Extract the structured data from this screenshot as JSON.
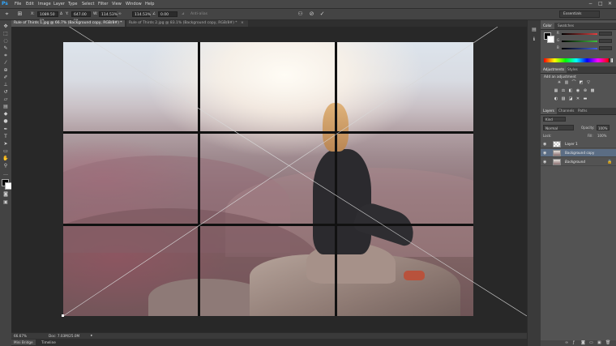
{
  "app": {
    "logo": "Ps"
  },
  "menu": [
    "File",
    "Edit",
    "Image",
    "Layer",
    "Type",
    "Select",
    "Filter",
    "View",
    "Window",
    "Help"
  ],
  "window_controls": {
    "minimize": "−",
    "maximize": "□",
    "close": "✕"
  },
  "options": {
    "x_label": "X:",
    "x_value": "1089.50 px",
    "y_label": "Y:",
    "y_value": "647.00 px",
    "w_label": "W:",
    "w_value": "114.53%",
    "h_value": "114.53%",
    "angle_value": "0.00",
    "antialias_label": "Anti-alias",
    "workspace": "Essentials"
  },
  "tabs": [
    {
      "label": "Rule of Thirds 1.jpg @ 66.7% (Background copy, RGB/8#) *",
      "close": "×",
      "active": true
    },
    {
      "label": "Rule of Thirds 2.jpg @ 83.1% (Background copy, RGB/8#) *",
      "close": "×",
      "active": false
    }
  ],
  "color_panel": {
    "tabs": [
      "Color",
      "Swatches"
    ],
    "sliders": [
      {
        "label": "R",
        "color": "#e04040"
      },
      {
        "label": "G",
        "color": "#40c040"
      },
      {
        "label": "B",
        "color": "#4060e0"
      }
    ]
  },
  "adjustments_panel": {
    "tabs": [
      "Adjustments",
      "Styles"
    ],
    "hint": "Add an adjustment"
  },
  "layers_panel": {
    "tabs": [
      "Layers",
      "Channels",
      "Paths"
    ],
    "kind_filter": "Kind",
    "blend_mode": "Normal",
    "opacity_label": "Opacity:",
    "opacity_value": "100%",
    "lock_label": "Lock:",
    "fill_label": "Fill:",
    "fill_value": "100%",
    "layers": [
      {
        "name": "Layer 1",
        "selected": false
      },
      {
        "name": "Background copy",
        "selected": true
      },
      {
        "name": "Background",
        "selected": false,
        "locked": true
      }
    ]
  },
  "status": {
    "zoom": "66.67%",
    "doc": "Doc: 7.03M/25.0M"
  },
  "bottom_tabs": [
    "Mini Bridge",
    "Timeline"
  ],
  "colors": {
    "accent": "#31a8ff",
    "selection": "#5b6d84"
  }
}
